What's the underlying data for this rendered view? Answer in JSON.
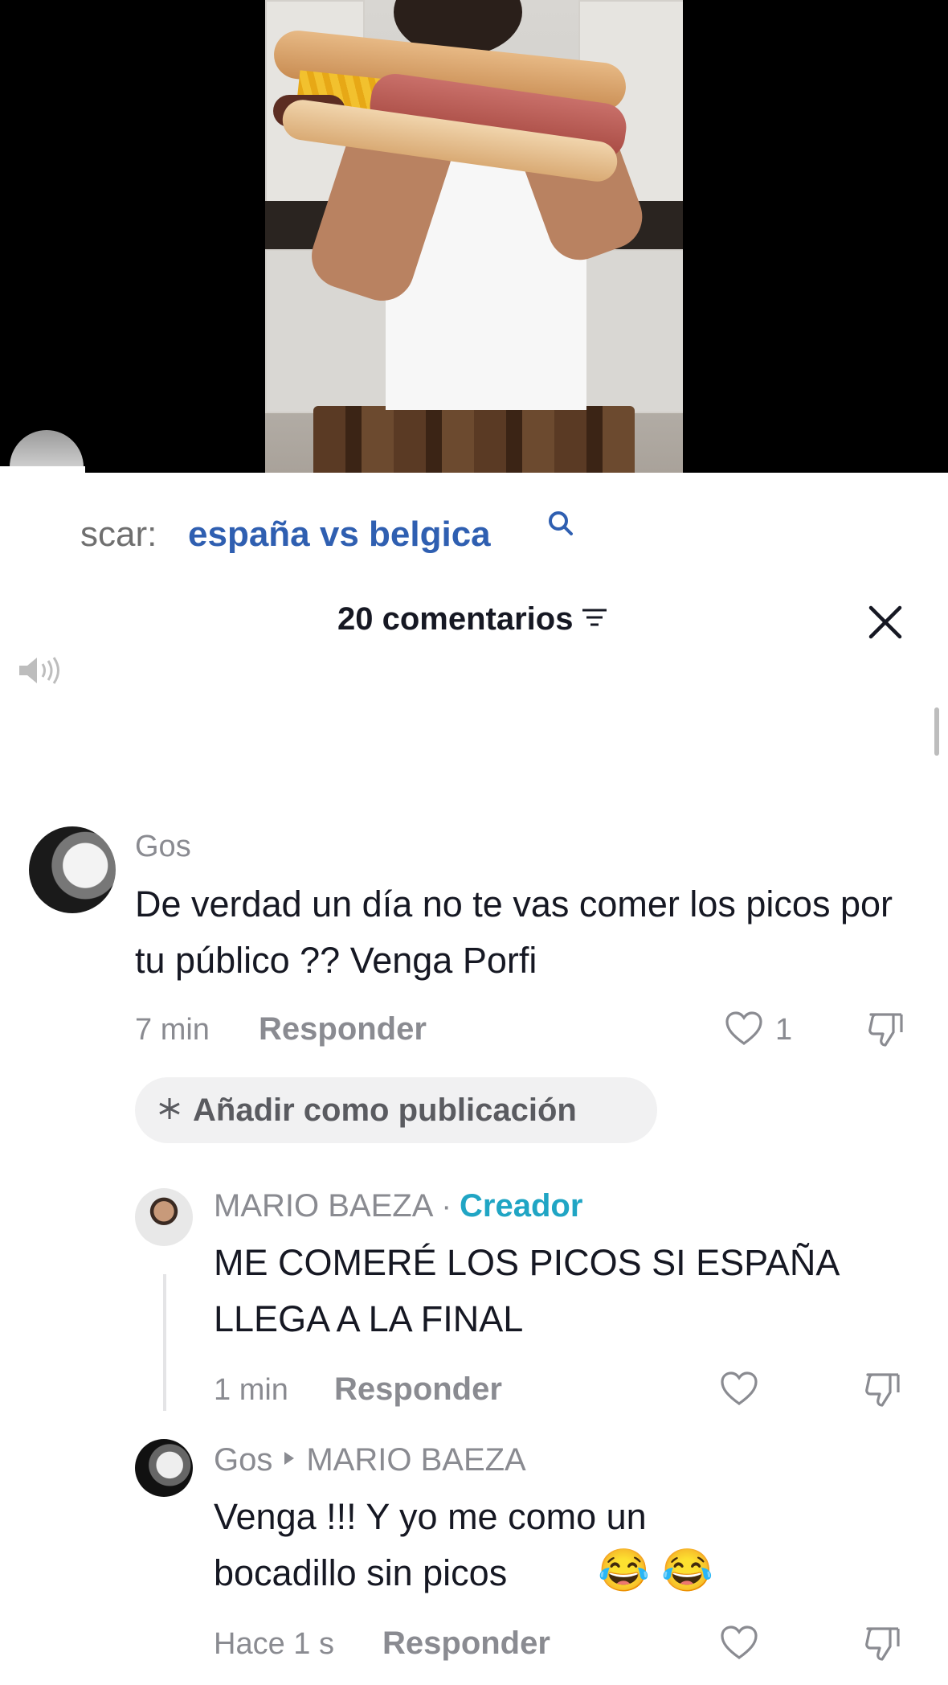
{
  "search": {
    "prefix": "scar:",
    "query": "españa vs belgica"
  },
  "comments_header": {
    "count_label": "20 comentarios"
  },
  "comments": [
    {
      "username": "Gos",
      "text": "De verdad un día no te vas comer los picos por tu público ?? Venga Porfi",
      "time": "7 min",
      "reply_label": "Responder",
      "like_count": "1",
      "add_post_label": "Añadir como publicación"
    }
  ],
  "replies": [
    {
      "username": "MARIO BAEZA",
      "separator": "·",
      "badge": "Creador",
      "text": "ME COMERÉ LOS PICOS SI ESPAÑA LLEGA A LA FINAL",
      "time": "1 min",
      "reply_label": "Responder"
    },
    {
      "username": "Gos",
      "reply_to": "MARIO BAEZA",
      "text": "Venga !!! Y yo me como un bocadillo sin picos",
      "emoji": "😂 😂",
      "time": "Hace 1 s",
      "reply_label": "Responder"
    }
  ],
  "colors": {
    "link_blue": "#2f5fb1",
    "creator_teal": "#20a5c4",
    "meta_gray": "#8a8b91"
  }
}
